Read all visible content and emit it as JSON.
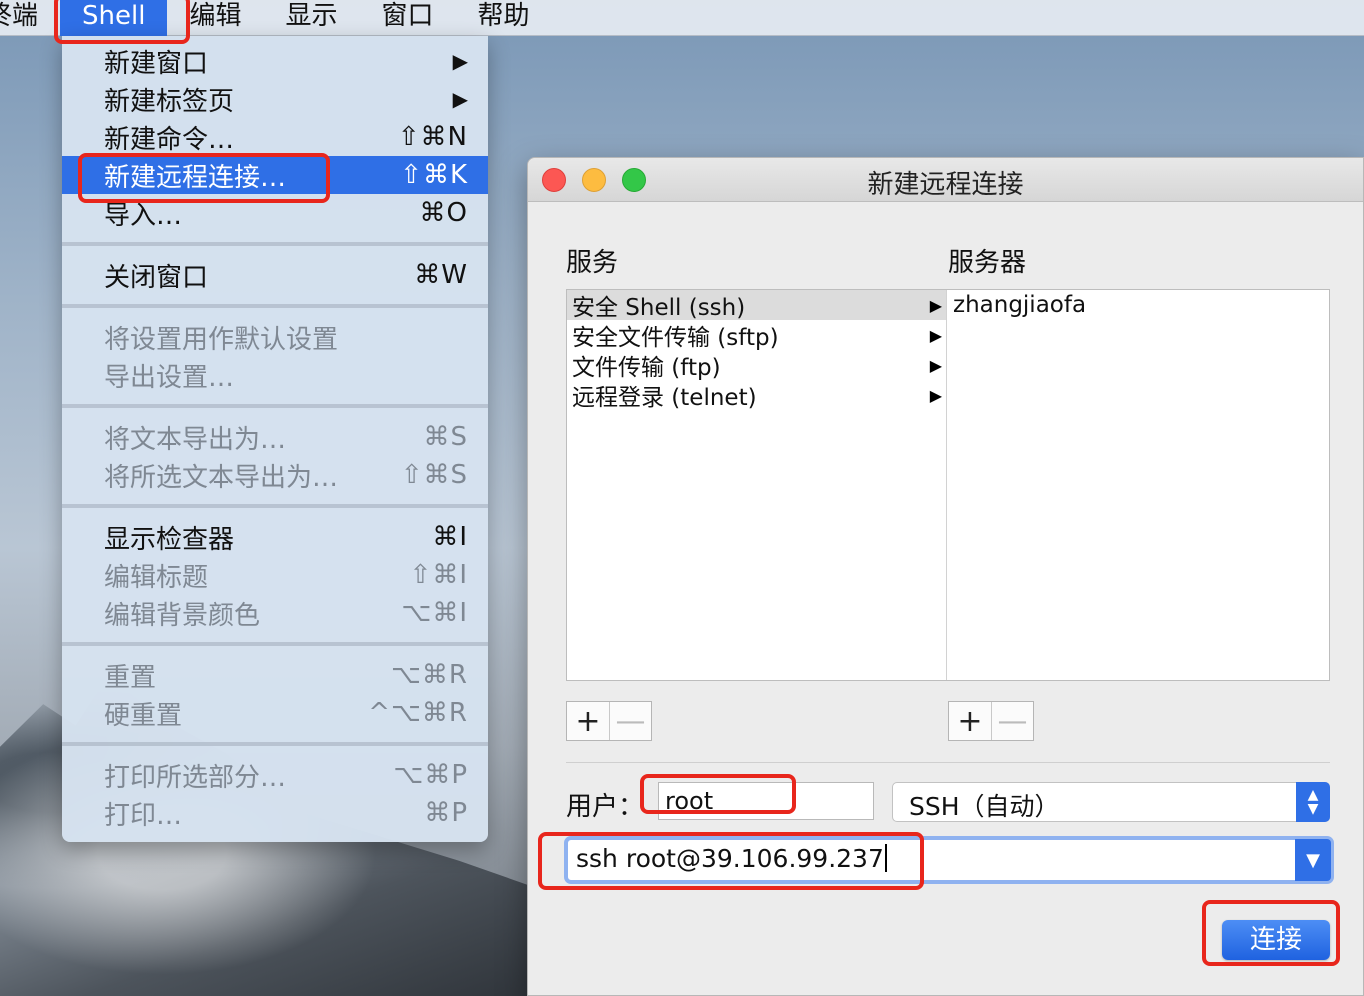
{
  "menubar": {
    "items": [
      "终端",
      "Shell",
      "编辑",
      "显示",
      "窗口",
      "帮助"
    ],
    "active_index": 1
  },
  "shell_menu": {
    "groups": [
      [
        {
          "label": "新建窗口",
          "shortcut": "",
          "submenu": true
        },
        {
          "label": "新建标签页",
          "shortcut": "",
          "submenu": true
        },
        {
          "label": "新建命令…",
          "shortcut": "⇧⌘N"
        },
        {
          "label": "新建远程连接…",
          "shortcut": "⇧⌘K",
          "selected": true
        },
        {
          "label": "导入…",
          "shortcut": "⌘O"
        }
      ],
      [
        {
          "label": "关闭窗口",
          "shortcut": "⌘W"
        }
      ],
      [
        {
          "label": "将设置用作默认设置",
          "shortcut": "",
          "disabled": true
        },
        {
          "label": "导出设置…",
          "shortcut": "",
          "disabled": true
        }
      ],
      [
        {
          "label": "将文本导出为…",
          "shortcut": "⌘S",
          "disabled": true
        },
        {
          "label": "将所选文本导出为…",
          "shortcut": "⇧⌘S",
          "disabled": true
        }
      ],
      [
        {
          "label": "显示检查器",
          "shortcut": "⌘I"
        },
        {
          "label": "编辑标题",
          "shortcut": "⇧⌘I",
          "disabled": true
        },
        {
          "label": "编辑背景颜色",
          "shortcut": "⌥⌘I",
          "disabled": true
        }
      ],
      [
        {
          "label": "重置",
          "shortcut": "⌥⌘R",
          "disabled": true
        },
        {
          "label": "硬重置",
          "shortcut": "^⌥⌘R",
          "disabled": true
        }
      ],
      [
        {
          "label": "打印所选部分…",
          "shortcut": "⌥⌘P",
          "disabled": true
        },
        {
          "label": "打印…",
          "shortcut": "⌘P",
          "disabled": true
        }
      ]
    ]
  },
  "dialog": {
    "title": "新建远程连接",
    "services_label": "服务",
    "servers_label": "服务器",
    "services": [
      {
        "label": "安全 Shell (ssh)",
        "selected": true
      },
      {
        "label": "安全文件传输 (sftp)"
      },
      {
        "label": "文件传输 (ftp)"
      },
      {
        "label": "远程登录 (telnet)"
      }
    ],
    "servers": [
      "zhangjiaofa"
    ],
    "add_symbol": "+",
    "remove_symbol": "—",
    "user_label": "用户：",
    "user_value": "root",
    "protocol_value": "SSH（自动）",
    "command_value": "ssh root@39.106.99.237",
    "connect_label": "连接"
  },
  "colors": {
    "accent": "#2f6fe6",
    "annotation": "#e8261c"
  }
}
